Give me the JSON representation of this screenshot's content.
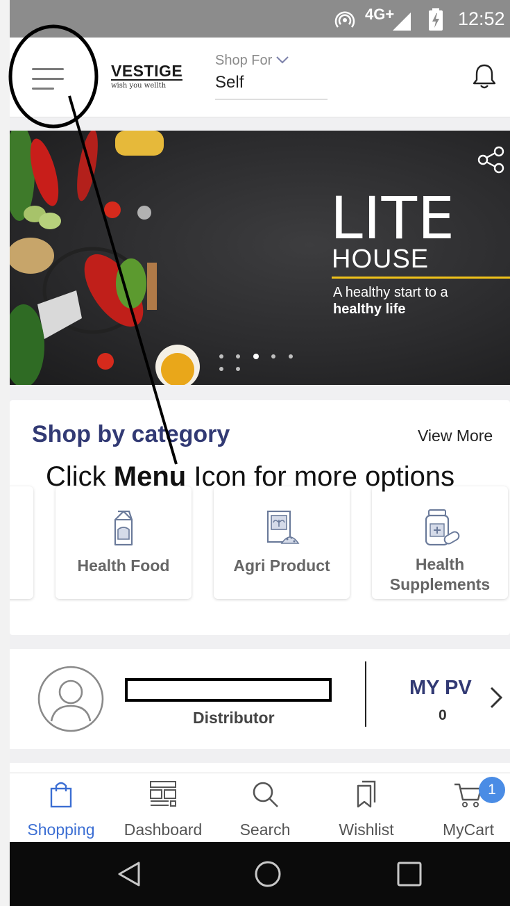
{
  "status_bar": {
    "network": "4G+",
    "time": "12:52"
  },
  "header": {
    "logo_word": "VESTIGE",
    "logo_tagline": "wish you wellth",
    "shop_for_label": "Shop For",
    "shop_for_value": "Self",
    "icons": [
      "menu-icon",
      "bell-icon"
    ]
  },
  "banner": {
    "title": "LITE",
    "subtitle": "HOUSE",
    "tagline_line1": "A healthy start to a",
    "tagline_line2": "healthy life",
    "slide_count": 7,
    "active_slide": 3,
    "accent_color": "#f0c21a"
  },
  "category": {
    "title": "Shop by category",
    "view_more": "View More",
    "items": [
      {
        "label": "Health Food",
        "icon": "milk-carton-icon"
      },
      {
        "label": "Agri Product",
        "icon": "seed-packet-icon"
      },
      {
        "label": "Health Supplements",
        "icon": "supplement-bottle-icon"
      }
    ]
  },
  "annotation": {
    "prefix": "Click ",
    "bold": "Menu",
    "suffix": " Icon for more options"
  },
  "profile": {
    "role": "Distributor",
    "pv_label": "MY PV",
    "pv_value": "0"
  },
  "bottom_nav": {
    "items": [
      {
        "label": "Shopping",
        "icon": "shopping-bag-icon",
        "active": true
      },
      {
        "label": "Dashboard",
        "icon": "dashboard-icon",
        "active": false
      },
      {
        "label": "Search",
        "icon": "search-icon",
        "active": false
      },
      {
        "label": "Wishlist",
        "icon": "wishlist-icon",
        "active": false
      },
      {
        "label": "MyCart",
        "icon": "cart-icon",
        "active": false
      }
    ],
    "cart_badge": "1"
  },
  "colors": {
    "brand_navy": "#323a74",
    "active_blue": "#3b6ed3",
    "badge_blue": "#4a8ce5",
    "status_bar": "#8c8c8c"
  }
}
